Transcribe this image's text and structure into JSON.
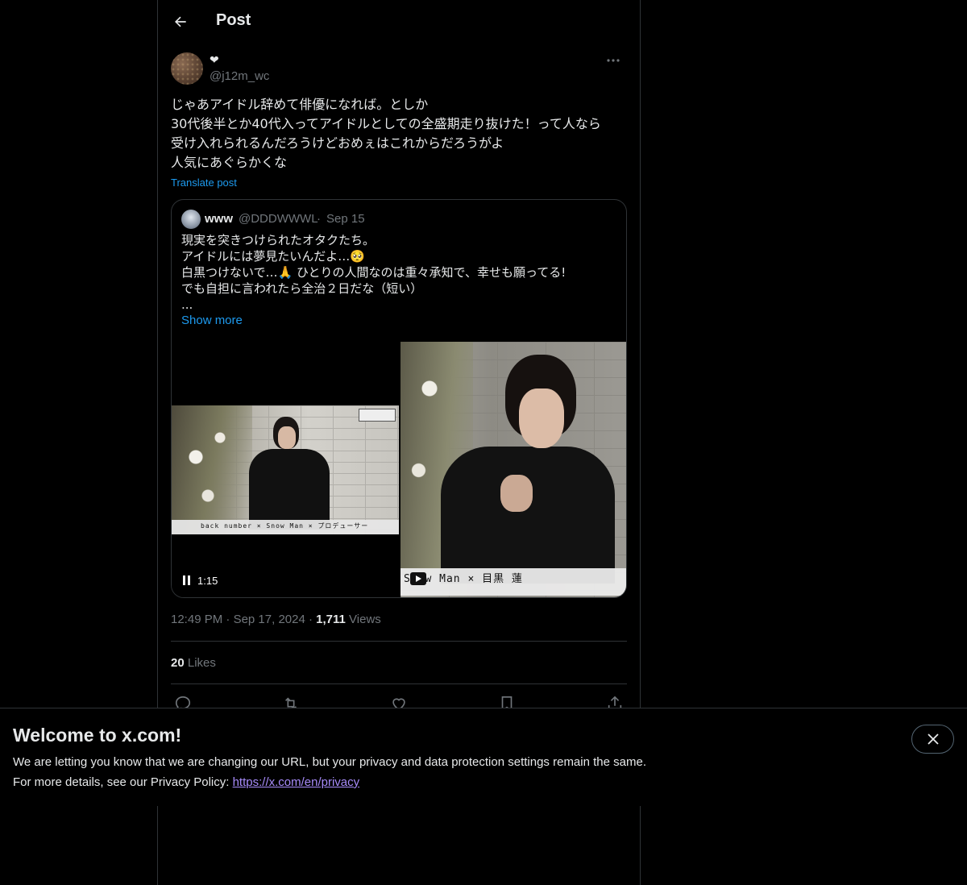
{
  "header": {
    "title": "Post"
  },
  "post": {
    "display_name": "❤",
    "handle": "@j12m_wc",
    "text_lines": [
      "じゃあアイドル辞めて俳優になれば。としか",
      "30代後半とか40代入ってアイドルとしての全盛期走り抜けた！って人なら",
      "受け入れられるんだろうけどおめぇはこれからだろうがよ",
      "人気にあぐらかくな"
    ],
    "translate_label": "Translate post",
    "time": "12:49 PM",
    "date": "Sep 17, 2024",
    "views_count": "1,711",
    "views_label": "Views",
    "likes_count": "20",
    "likes_label": "Likes"
  },
  "quote": {
    "name": "www",
    "handle": "@DDDWWWL",
    "dot": "·",
    "date": "Sep 15",
    "text_lines": [
      "現実を突きつけられたオタクたち。",
      "アイドルには夢見たいんだよ…🥺",
      "白黒つけないで…🙏 ひとりの人間なのは重々承知で、幸せも願ってる!",
      "でも自担に言われたら全治２日だな（短い）",
      "..."
    ],
    "show_more": "Show more",
    "video_time": "1:15",
    "left_caption": "back number × Snow Man × プロデューサー",
    "right_caption": "Snow Man × 目黒 蓮"
  },
  "banner": {
    "title": "Welcome to x.com!",
    "line1": "We are letting you know that we are changing our URL, but your privacy and data protection settings remain the same.",
    "line2_prefix": "For more details, see our Privacy Policy: ",
    "link": "https://x.com/en/privacy"
  },
  "colors": {
    "accent": "#1d9bf0",
    "background": "#000000",
    "border": "#2f3336",
    "muted": "#71767b"
  },
  "icons": [
    "back-arrow-icon",
    "more-icon",
    "pause-icon",
    "play-icon",
    "reply-icon",
    "repost-icon",
    "like-icon",
    "bookmark-icon",
    "share-icon",
    "close-icon"
  ]
}
